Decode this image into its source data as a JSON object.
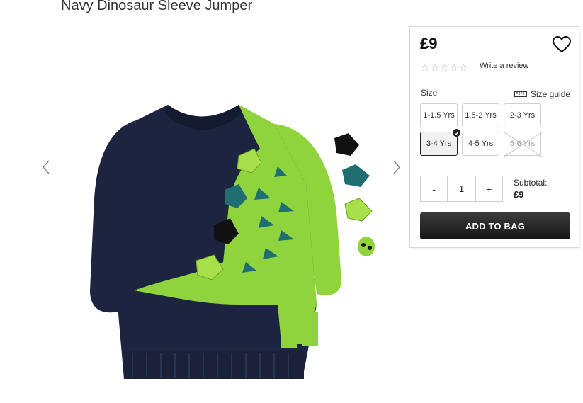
{
  "product": {
    "title": "Navy Dinosaur Sleeve Jumper"
  },
  "gallery": {
    "image_label": "Navy Dinosaur Sleeve Jumper product image",
    "prev_icon": "chevron-left-icon",
    "next_icon": "chevron-right-icon"
  },
  "panel": {
    "price": "£9",
    "wishlist_icon": "heart-icon",
    "rating": {
      "stars": 5,
      "filled": 0
    },
    "review_link": "Write a review",
    "size_label": "Size",
    "size_guide_label": "Size guide",
    "size_guide_icon": "ruler-icon",
    "sizes": [
      {
        "label": "1-1.5 Yrs",
        "selected": false,
        "available": true
      },
      {
        "label": "1.5-2 Yrs",
        "selected": false,
        "available": true
      },
      {
        "label": "2-3 Yrs",
        "selected": false,
        "available": true
      },
      {
        "label": "3-4 Yrs",
        "selected": true,
        "available": true
      },
      {
        "label": "4-5 Yrs",
        "selected": false,
        "available": true
      },
      {
        "label": "5-6 Yrs",
        "selected": false,
        "available": false
      }
    ],
    "quantity": {
      "minus": "-",
      "value": "1",
      "plus": "+"
    },
    "subtotal_label": "Subtotal:",
    "subtotal_value": "£9",
    "add_to_bag": "ADD TO BAG"
  },
  "colors": {
    "navy": "#1c2440",
    "lime": "#8fd43c",
    "teal": "#1f6f72",
    "button_dark": "#1b1b1b"
  }
}
